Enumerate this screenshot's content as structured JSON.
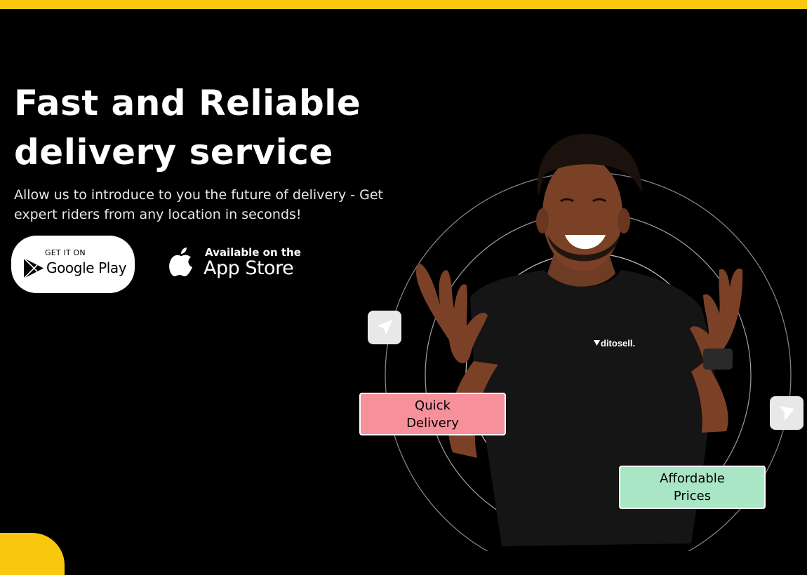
{
  "hero": {
    "title_line1": "Fast and Reliable",
    "title_line2": "delivery service",
    "subtitle": "Allow us to introduce to you the future of delivery - Get expert riders from any location in seconds!"
  },
  "store_buttons": {
    "google": {
      "small": "GET IT ON",
      "big": "Google Play"
    },
    "apple": {
      "small": "Available on the",
      "big": "App Store"
    }
  },
  "tags": {
    "quick_line1": "Quick",
    "quick_line2": "Delivery",
    "price_line1": "Affordable",
    "price_line2": "Prices"
  },
  "shirt_brand": "ditosell.",
  "colors": {
    "accent": "#f9c80e",
    "background": "#000000",
    "quick_tag": "#f6919c",
    "price_tag": "#a9e6c5"
  },
  "icons": [
    "google-play-icon",
    "apple-icon",
    "navigation-arrow-icon"
  ]
}
